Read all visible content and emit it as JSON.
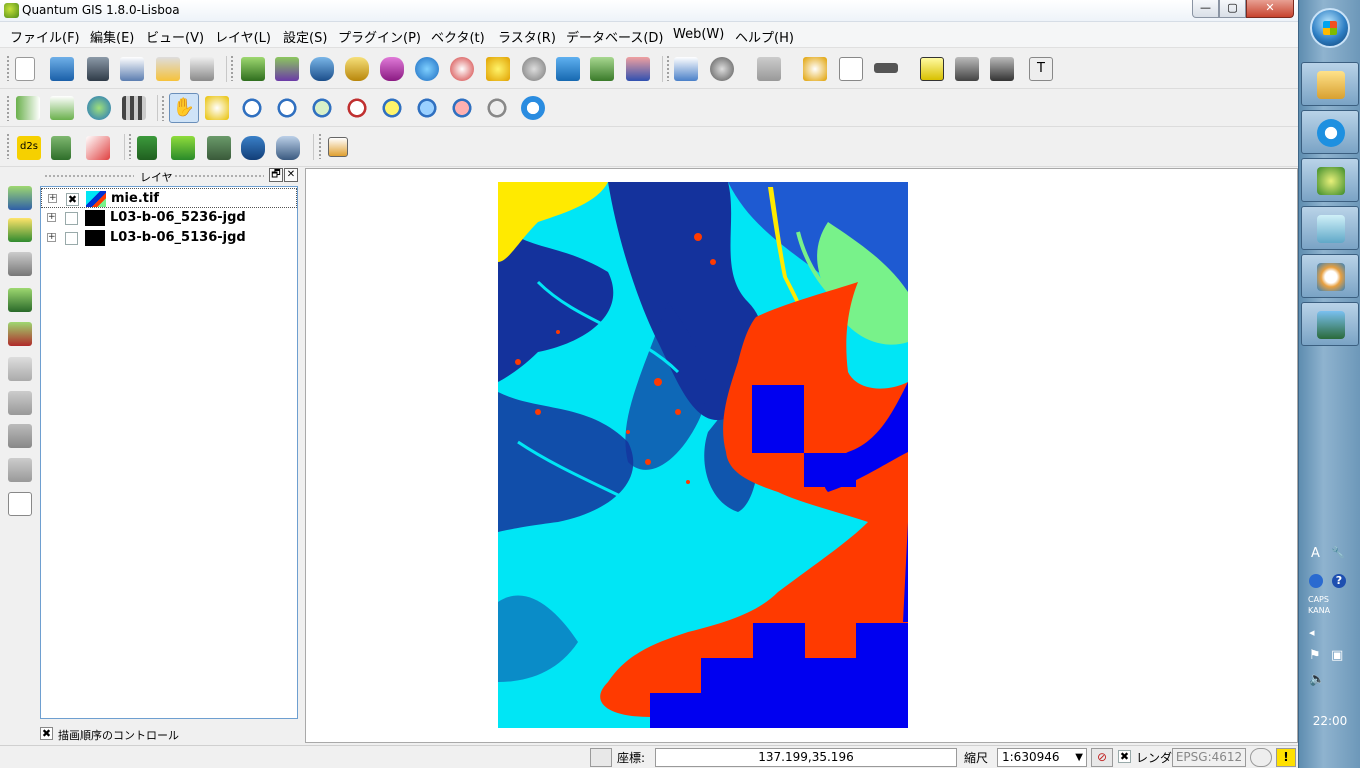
{
  "window": {
    "title": "Quantum GIS 1.8.0-Lisboa",
    "controls": {
      "minimize": "—",
      "maximize": "▢",
      "close": "✕"
    }
  },
  "menu": [
    {
      "label": "ファイル(F)"
    },
    {
      "label": "編集(E)"
    },
    {
      "label": "ビュー(V)"
    },
    {
      "label": "レイヤ(L)"
    },
    {
      "label": "設定(S)"
    },
    {
      "label": "プラグイン(P)"
    },
    {
      "label": "ベクタ(t)"
    },
    {
      "label": "ラスタ(R)"
    },
    {
      "label": "データベース(D)"
    },
    {
      "label": "Web(W)"
    },
    {
      "label": "ヘルプ(H)"
    }
  ],
  "toolbar_icons": {
    "row1": [
      "new-project-icon",
      "open-project-icon",
      "save-project-icon",
      "save-as-icon",
      "print-composer-icon",
      "composer-manager-icon",
      "add-vector-layer-icon",
      "add-raster-layer-icon",
      "add-postgis-layer-icon",
      "add-spatialite-layer-icon",
      "add-mssql-layer-icon",
      "add-wms-layer-icon",
      "add-wfs-layer-icon",
      "new-shapefile-icon",
      "remove-layer-icon",
      "add-delimited-text-icon",
      "add-csv-icon",
      "add-gps-icon",
      "identify-icon",
      "action-icon",
      "select-icon",
      "deselect-icon",
      "attribute-table-icon",
      "measure-icon",
      "map-tips-icon",
      "new-bookmark-icon",
      "show-bookmarks-icon",
      "text-annotation-icon"
    ],
    "row2": [
      "histogram-stretch-icon",
      "local-histogram-icon",
      "globe-icon",
      "raster-calculator-icon",
      "pan-icon",
      "pan-to-selection-icon",
      "zoom-in-icon",
      "zoom-out-icon",
      "zoom-full-icon",
      "zoom-to-selection-icon",
      "zoom-to-layer-icon",
      "zoom-native-icon",
      "zoom-last-icon",
      "zoom-next-icon",
      "refresh-icon"
    ],
    "row3": [
      "d2s-icon",
      "add-feature-plugin-icon",
      "vertex-tool-icon",
      "digitize-icon",
      "georeferencer-icon",
      "image-icon",
      "postgis-icon",
      "database-icon",
      "script-icon"
    ]
  },
  "left_tools": [
    "add-vector-icon",
    "add-raster-icon",
    "remove-icon",
    "add-postgis-icon",
    "add-spatialite-icon",
    "add-wms-icon",
    "add-wfs-icon",
    "edit-icon",
    "node-tool-icon",
    "layer-properties-icon",
    "layer-attributes-icon"
  ],
  "layer_panel": {
    "title": "レイヤ",
    "float_btn": "🗗",
    "close_btn": "✕",
    "layers": [
      {
        "name": "mie.tif",
        "checked": true,
        "selected": true,
        "checkmark": "✖"
      },
      {
        "name": "L03-b-06_5236-jgd",
        "checked": false,
        "selected": false,
        "checkmark": ""
      },
      {
        "name": "L03-b-06_5136-jgd",
        "checked": false,
        "selected": false,
        "checkmark": ""
      }
    ],
    "order_control": {
      "label": "描画順序のコントロール",
      "checked": true,
      "checkmark": "✖"
    }
  },
  "map": {
    "colors": {
      "water": "#0032d2",
      "sea": "#00e6f5",
      "land": "#14329c",
      "veg": "#78f28a",
      "urban": "#ff3a00",
      "yellow": "#ffea00",
      "blue_block": "#0000f0"
    }
  },
  "status": {
    "coord_label": "座標:",
    "coord_value": "137.199,35.196",
    "scale_label": "縮尺",
    "scale_value": "1:630946",
    "scale_dropdown_arrow": "▼",
    "render_label": "レンダ",
    "render_checked": true,
    "render_checkmark": "✖",
    "crs": "EPSG:4612",
    "warning": "!"
  },
  "taskbar": {
    "apps": [
      "folder-icon",
      "internet-explorer-icon",
      "qgis-icon",
      "notepad-icon",
      "paint-icon",
      "photo-viewer-icon"
    ],
    "tray": {
      "ime": "A",
      "caps": "CAPS",
      "kana": "KANA",
      "help": "?"
    },
    "clock": "22:00"
  }
}
